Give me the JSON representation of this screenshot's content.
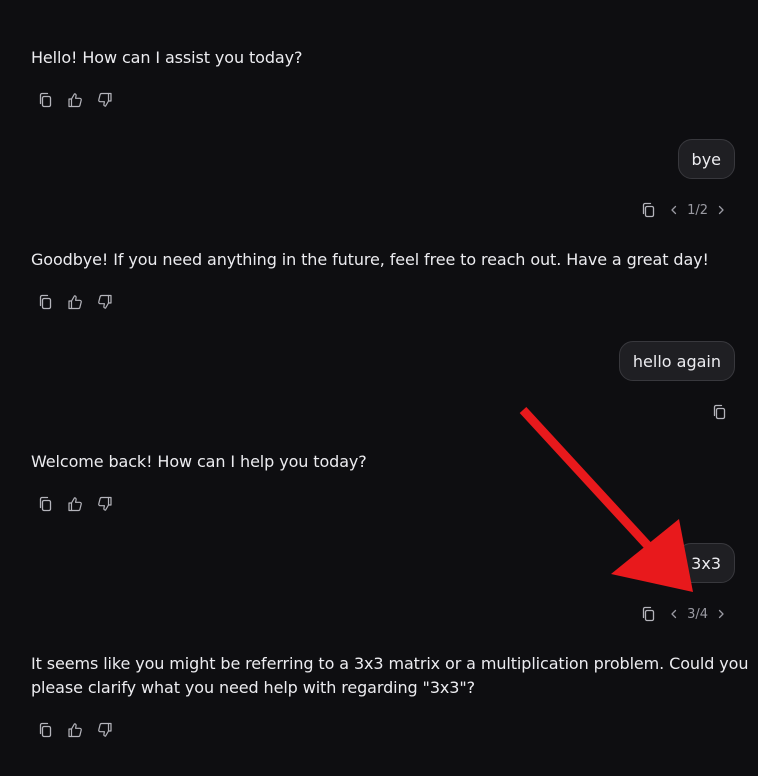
{
  "messages": {
    "a1": "Hello! How can I assist you today?",
    "u1": "bye",
    "u1_pager": "1/2",
    "a2": "Goodbye! If you need anything in the future, feel free to reach out. Have a great day!",
    "u2": "hello again",
    "a3": "Welcome back! How can I help you today?",
    "u3": "3x3",
    "u3_pager": "3/4",
    "a4_line1": "It seems like you might be referring to a 3x3 matrix or a multiplication problem. Could you",
    "a4_line2": "please clarify what you need help with regarding \"3x3\"?"
  },
  "icons": {
    "copy": "copy-icon",
    "like": "thumbs-up-icon",
    "dislike": "thumbs-down-icon",
    "prev": "chevron-left-icon",
    "next": "chevron-right-icon"
  },
  "annotation": {
    "arrow_color": "#e8191c"
  }
}
